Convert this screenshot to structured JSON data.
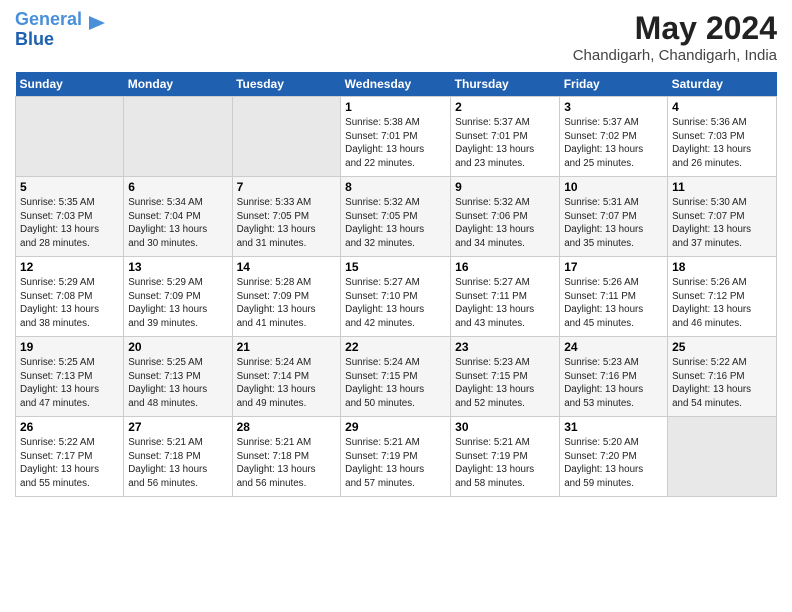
{
  "app": {
    "logo_line1": "General",
    "logo_line2": "Blue"
  },
  "header": {
    "title": "May 2024",
    "subtitle": "Chandigarh, Chandigarh, India"
  },
  "weekdays": [
    "Sunday",
    "Monday",
    "Tuesday",
    "Wednesday",
    "Thursday",
    "Friday",
    "Saturday"
  ],
  "weeks": [
    [
      {
        "day": "",
        "info": ""
      },
      {
        "day": "",
        "info": ""
      },
      {
        "day": "",
        "info": ""
      },
      {
        "day": "1",
        "info": "Sunrise: 5:38 AM\nSunset: 7:01 PM\nDaylight: 13 hours\nand 22 minutes."
      },
      {
        "day": "2",
        "info": "Sunrise: 5:37 AM\nSunset: 7:01 PM\nDaylight: 13 hours\nand 23 minutes."
      },
      {
        "day": "3",
        "info": "Sunrise: 5:37 AM\nSunset: 7:02 PM\nDaylight: 13 hours\nand 25 minutes."
      },
      {
        "day": "4",
        "info": "Sunrise: 5:36 AM\nSunset: 7:03 PM\nDaylight: 13 hours\nand 26 minutes."
      }
    ],
    [
      {
        "day": "5",
        "info": "Sunrise: 5:35 AM\nSunset: 7:03 PM\nDaylight: 13 hours\nand 28 minutes."
      },
      {
        "day": "6",
        "info": "Sunrise: 5:34 AM\nSunset: 7:04 PM\nDaylight: 13 hours\nand 30 minutes."
      },
      {
        "day": "7",
        "info": "Sunrise: 5:33 AM\nSunset: 7:05 PM\nDaylight: 13 hours\nand 31 minutes."
      },
      {
        "day": "8",
        "info": "Sunrise: 5:32 AM\nSunset: 7:05 PM\nDaylight: 13 hours\nand 32 minutes."
      },
      {
        "day": "9",
        "info": "Sunrise: 5:32 AM\nSunset: 7:06 PM\nDaylight: 13 hours\nand 34 minutes."
      },
      {
        "day": "10",
        "info": "Sunrise: 5:31 AM\nSunset: 7:07 PM\nDaylight: 13 hours\nand 35 minutes."
      },
      {
        "day": "11",
        "info": "Sunrise: 5:30 AM\nSunset: 7:07 PM\nDaylight: 13 hours\nand 37 minutes."
      }
    ],
    [
      {
        "day": "12",
        "info": "Sunrise: 5:29 AM\nSunset: 7:08 PM\nDaylight: 13 hours\nand 38 minutes."
      },
      {
        "day": "13",
        "info": "Sunrise: 5:29 AM\nSunset: 7:09 PM\nDaylight: 13 hours\nand 39 minutes."
      },
      {
        "day": "14",
        "info": "Sunrise: 5:28 AM\nSunset: 7:09 PM\nDaylight: 13 hours\nand 41 minutes."
      },
      {
        "day": "15",
        "info": "Sunrise: 5:27 AM\nSunset: 7:10 PM\nDaylight: 13 hours\nand 42 minutes."
      },
      {
        "day": "16",
        "info": "Sunrise: 5:27 AM\nSunset: 7:11 PM\nDaylight: 13 hours\nand 43 minutes."
      },
      {
        "day": "17",
        "info": "Sunrise: 5:26 AM\nSunset: 7:11 PM\nDaylight: 13 hours\nand 45 minutes."
      },
      {
        "day": "18",
        "info": "Sunrise: 5:26 AM\nSunset: 7:12 PM\nDaylight: 13 hours\nand 46 minutes."
      }
    ],
    [
      {
        "day": "19",
        "info": "Sunrise: 5:25 AM\nSunset: 7:13 PM\nDaylight: 13 hours\nand 47 minutes."
      },
      {
        "day": "20",
        "info": "Sunrise: 5:25 AM\nSunset: 7:13 PM\nDaylight: 13 hours\nand 48 minutes."
      },
      {
        "day": "21",
        "info": "Sunrise: 5:24 AM\nSunset: 7:14 PM\nDaylight: 13 hours\nand 49 minutes."
      },
      {
        "day": "22",
        "info": "Sunrise: 5:24 AM\nSunset: 7:15 PM\nDaylight: 13 hours\nand 50 minutes."
      },
      {
        "day": "23",
        "info": "Sunrise: 5:23 AM\nSunset: 7:15 PM\nDaylight: 13 hours\nand 52 minutes."
      },
      {
        "day": "24",
        "info": "Sunrise: 5:23 AM\nSunset: 7:16 PM\nDaylight: 13 hours\nand 53 minutes."
      },
      {
        "day": "25",
        "info": "Sunrise: 5:22 AM\nSunset: 7:16 PM\nDaylight: 13 hours\nand 54 minutes."
      }
    ],
    [
      {
        "day": "26",
        "info": "Sunrise: 5:22 AM\nSunset: 7:17 PM\nDaylight: 13 hours\nand 55 minutes."
      },
      {
        "day": "27",
        "info": "Sunrise: 5:21 AM\nSunset: 7:18 PM\nDaylight: 13 hours\nand 56 minutes."
      },
      {
        "day": "28",
        "info": "Sunrise: 5:21 AM\nSunset: 7:18 PM\nDaylight: 13 hours\nand 56 minutes."
      },
      {
        "day": "29",
        "info": "Sunrise: 5:21 AM\nSunset: 7:19 PM\nDaylight: 13 hours\nand 57 minutes."
      },
      {
        "day": "30",
        "info": "Sunrise: 5:21 AM\nSunset: 7:19 PM\nDaylight: 13 hours\nand 58 minutes."
      },
      {
        "day": "31",
        "info": "Sunrise: 5:20 AM\nSunset: 7:20 PM\nDaylight: 13 hours\nand 59 minutes."
      },
      {
        "day": "",
        "info": ""
      }
    ]
  ]
}
